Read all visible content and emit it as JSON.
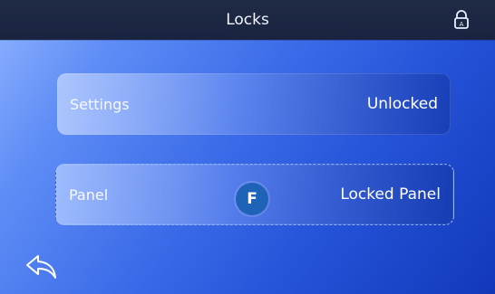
{
  "header": {
    "title": "Locks",
    "lock_icon": "lock-icon"
  },
  "settings_card": {
    "label": "Settings",
    "status": "Unlocked"
  },
  "panel_card": {
    "label": "Panel",
    "badge": "F",
    "status": "Locked Panel"
  },
  "footer": {
    "back_icon": "back-arrow-icon"
  },
  "colors": {
    "header_bg": "#1f2a45",
    "badge_bg": "#1e63b8",
    "text": "#ffffff"
  }
}
